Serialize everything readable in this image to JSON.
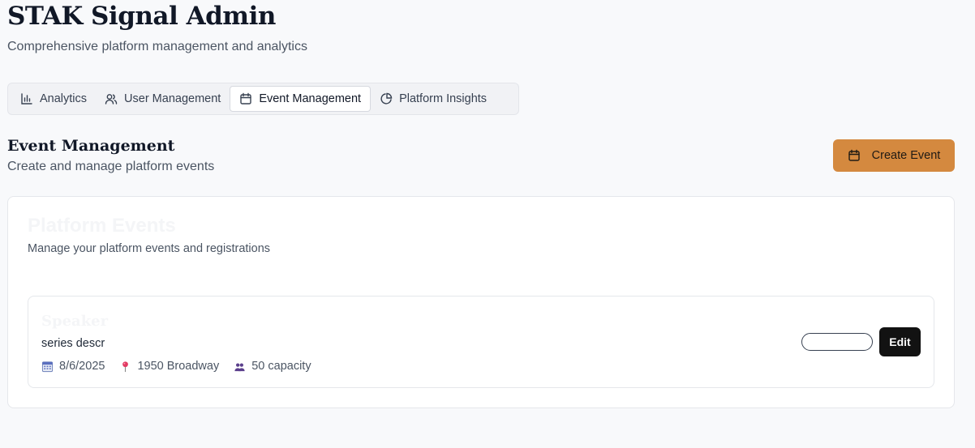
{
  "header": {
    "title": "STAK Signal Admin",
    "subtitle": "Comprehensive platform management and analytics"
  },
  "tabs": [
    {
      "label": "Analytics",
      "icon": "bar-chart-icon",
      "active": false
    },
    {
      "label": "User Management",
      "icon": "users-icon",
      "active": false
    },
    {
      "label": "Event Management",
      "icon": "calendar-icon",
      "active": true
    },
    {
      "label": "Platform Insights",
      "icon": "pie-chart-icon",
      "active": false
    }
  ],
  "section": {
    "title": "Event Management",
    "subtitle": "Create and manage platform events",
    "create_label": "Create Event"
  },
  "card": {
    "title": "Platform Events",
    "subtitle": "Manage your platform events and registrations"
  },
  "events": [
    {
      "title": "Speaker",
      "description": "series descr",
      "date": "8/6/2025",
      "location": "1950 Broadway",
      "capacity": "50 capacity",
      "status": "",
      "edit_label": "Edit"
    }
  ],
  "colors": {
    "accent": "#d4893f",
    "edit_button": "#121212",
    "background": "#f8f9fb"
  }
}
